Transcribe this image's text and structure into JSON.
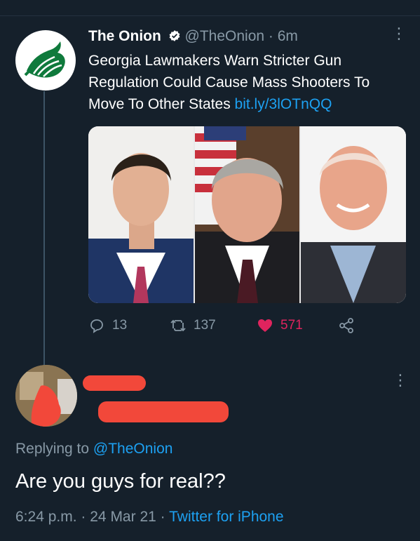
{
  "tweet": {
    "name": "The Onion",
    "handle": "@TheOnion",
    "separator": "·",
    "time": "6m",
    "text": "Georgia Lawmakers Warn Stricter Gun Regulation Could Cause Mass Shooters To Move To Other States ",
    "link": "bit.ly/3lOTnQQ",
    "stats": {
      "replies": "13",
      "retweets": "137",
      "likes": "571"
    },
    "media_description": "three lawmakers"
  },
  "reply": {
    "replying_prefix": "Replying to ",
    "replying_handle": "@TheOnion",
    "text": "Are you guys for real??",
    "time": "6:24 p.m.",
    "date": "24 Mar 21",
    "separator": "·",
    "source": "Twitter for iPhone"
  },
  "colors": {
    "background": "#15202b",
    "accent": "#1da1f2",
    "like": "#e0245e",
    "muted": "#8899a6",
    "onion_green": "#0f7a3c",
    "redaction": "#f2483a"
  },
  "icons": [
    "verified-icon",
    "more-icon",
    "reply-icon",
    "retweet-icon",
    "heart-icon",
    "share-icon",
    "onion-logo"
  ]
}
